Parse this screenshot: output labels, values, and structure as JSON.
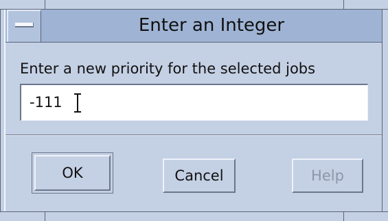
{
  "window": {
    "title": "Enter an Integer",
    "menu_button_icon": "window-menu-icon"
  },
  "dialog": {
    "prompt": "Enter a new priority for the selected jobs",
    "input_value": "-111"
  },
  "buttons": {
    "ok_label": "OK",
    "cancel_label": "Cancel",
    "help_label": "Help",
    "help_disabled": true
  },
  "colors": {
    "background": "#c4d0e4",
    "titlebar": "#9fb4d4",
    "disabled_text": "#8d97a8"
  }
}
